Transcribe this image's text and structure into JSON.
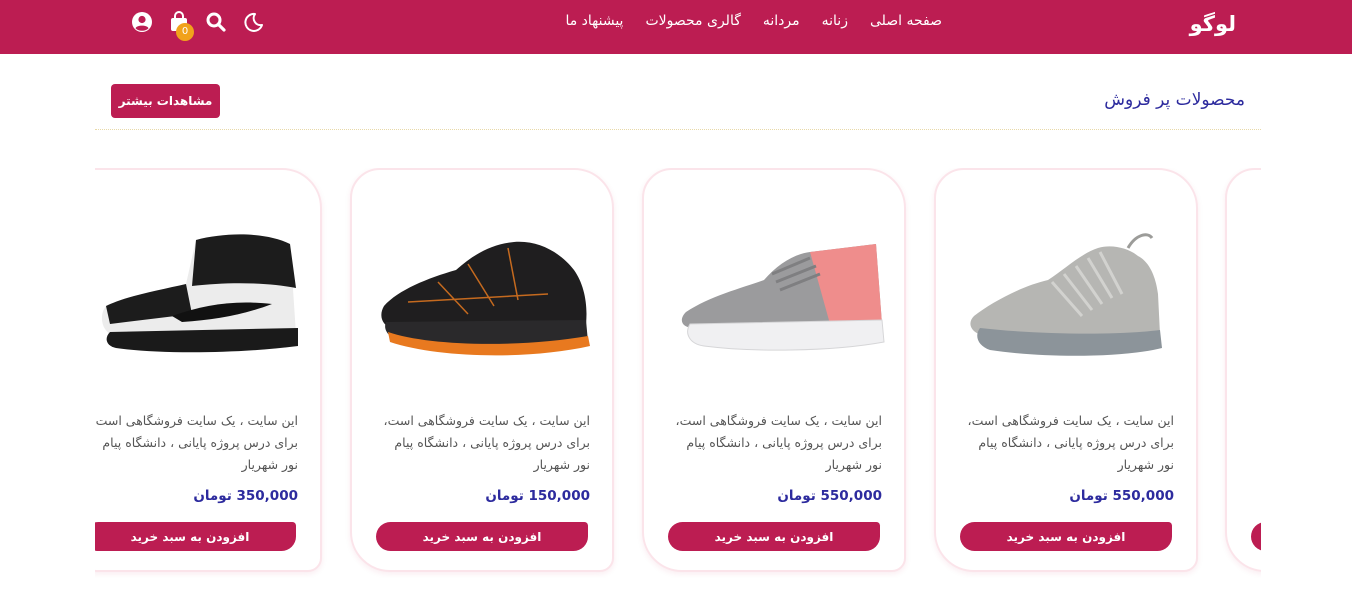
{
  "header": {
    "logo": "لوگو",
    "menu": [
      "صفحه اصلی",
      "زنانه",
      "مردانه",
      "گالری محصولات",
      "پیشنهاد ما"
    ],
    "cart_count": "0",
    "icons": [
      "user-icon",
      "cart-icon",
      "search-icon",
      "moon-icon"
    ],
    "color": "#bc1d52"
  },
  "section": {
    "title": "محصولات پر فروش",
    "more_label": "مشاهدات بیشتر"
  },
  "products": [
    {
      "desc": "این سایت ، یک سایت فروشگاهی است، برای درس پروژه پایانی ، دانشگاه پیام نور شهریار",
      "price": "550,000 تومان",
      "button": "افزودن به سبد خرید",
      "shoe": "grey-knit-sneaker"
    },
    {
      "desc": "این سایت ، یک سایت فروشگاهی است، برای درس پروژه پایانی ، دانشگاه پیام نور شهریار",
      "price": "550,000 تومان",
      "button": "افزودن به سبد خرید",
      "shoe": "grey-pink-sneaker"
    },
    {
      "desc": "این سایت ، یک سایت فروشگاهی است، برای درس پروژه پایانی ، دانشگاه پیام نور شهریار",
      "price": "150,000 تومان",
      "button": "افزودن به سبد خرید",
      "shoe": "black-orange-sneaker"
    },
    {
      "desc": "این سایت ، یک سایت فروشگاهی است، برای درس پروژه پایانی ، دانشگاه پیام نور شهریار",
      "price": "350,000 تومان",
      "button": "افزودن به سبد خرید",
      "shoe": "black-white-high-top"
    }
  ]
}
